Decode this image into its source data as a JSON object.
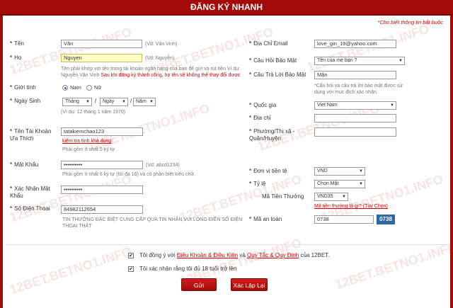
{
  "header": {
    "title": "ĐĂNG KÝ NHANH"
  },
  "required_note": "*Cho biết thông tin bắt buộc",
  "watermark": "12BET.BETNO1.INFO",
  "left": {
    "ten": {
      "label": "Tên",
      "value": "Văn",
      "hint": "(Vd: Văn Vinh)"
    },
    "ho": {
      "label": "Họ",
      "value": "Nguyen",
      "hint": "(Vd: Nguyễn)",
      "note": "Tên phải khớp với tên trong tài khoản ngân hàng của bạn để gửi và rút tiền Ví dụ: Nguyễn Văn Vinh",
      "note_red": "Sau khi đăng ký thành công, họ tên sẽ không thể thay đổi được"
    },
    "gender": {
      "label": "Giới tính",
      "male": "Nam",
      "female": "Nữ"
    },
    "birthday": {
      "label": "Ngày Sinh",
      "month": "Tháng",
      "day": "Ngày",
      "year": "Năm",
      "hint": "(Ví dụ: 12 tháng 1 năm 1970)"
    },
    "username": {
      "label": "Tên Tài Khoản Ưa Thích",
      "value": "tatakiemchao123",
      "check_link": "kiểm tra tính khả dụng",
      "hint": "Phải gồm ít nhất 5 ký tự"
    },
    "password": {
      "label": "Mật Khẩu",
      "value": "••••••••••",
      "example": "(Vd: abcd1234)",
      "hint": "Phải gồm ít nhất 6 ký tự (tối đa 16) và có phần biệt kiểu chữ."
    },
    "confirm_password": {
      "label": "Xác Nhận Mật Khẩu",
      "value": "••••••••••"
    },
    "phone": {
      "label": "Số Điện Thoại",
      "value": "84982112654",
      "hint": "TIN THƯỞNG ĐẶC BIỆT CUNG CẤP QUA TIN NHẮN VUI LÒNG ĐIỀN SỐ ĐIỆN THOẠI THẬT"
    }
  },
  "right": {
    "email": {
      "label": "Địa Chỉ Email",
      "value": "love_gin_19@yahoo.com"
    },
    "question": {
      "label": "Câu Hỏi Bảo Mật",
      "value": "Tên của mẹ bạn ?"
    },
    "answer": {
      "label": "Câu Trả Lời Bảo Mật",
      "value": "Mận",
      "hint": "*Câu hỏi và câu trả lời bảo mật được sử dụng với mục đích xác nhận."
    },
    "country": {
      "label": "Quốc gia",
      "value": "Viet Nam"
    },
    "address": {
      "label": "Địa chỉ",
      "value": ""
    },
    "ward": {
      "label": "Phường/Thị xã - Quận/Huyện",
      "value": ""
    },
    "currency": {
      "label": "Đơn vị tiền tệ",
      "value": "VND"
    },
    "odds": {
      "label": "Tỷ lệ",
      "value": "Chọn Mặt"
    },
    "bonus_code": {
      "label": "Mã Tiền Thưởng",
      "value": "VND35",
      "link": "Mã tiền thưởng là gì? (Tùy Chọn)"
    },
    "captcha": {
      "label": "Mã an toàn",
      "value": "0738",
      "code": "0738"
    }
  },
  "agreements": {
    "terms_prefix": "Tôi đồng ý với ",
    "terms_link1": "Điều Khoản & Điều Kiện",
    "terms_mid": " và ",
    "terms_link2": "Quy Tắc & Quy Định",
    "terms_suffix": " của 12BET.",
    "age": "Tôi xác nhận rằng tôi đủ 18 tuổi trở lên"
  },
  "buttons": {
    "submit": "Gửi",
    "reset": "Xác Lập Lại"
  }
}
